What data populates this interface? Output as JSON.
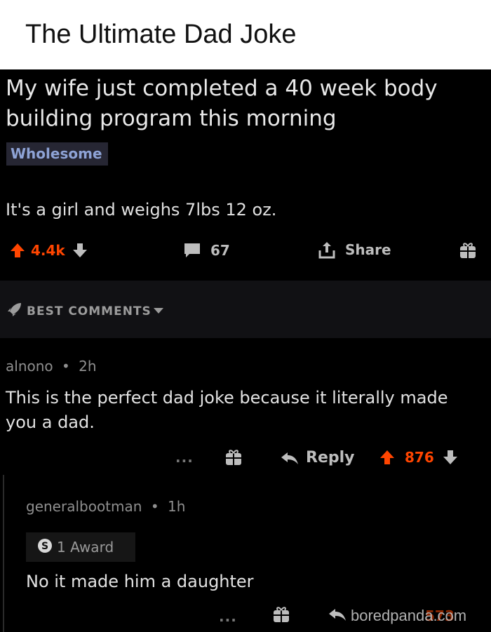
{
  "article_title": "The Ultimate Dad Joke",
  "post": {
    "title": "My wife just completed a 40 week body building program this morning",
    "flair": "Wholesome",
    "body": "It's a girl and weighs 7lbs 12 oz.",
    "score": "4.4k",
    "comment_count": "67",
    "share_label": "Share"
  },
  "sort": {
    "label": "BEST COMMENTS"
  },
  "comments": [
    {
      "author": "alnono",
      "age": "2h",
      "text": "This is the perfect dad joke because it literally made you a dad.",
      "more": "...",
      "reply_label": "Reply",
      "score": "876"
    },
    {
      "author": "generalbootman",
      "age": "1h",
      "award": "1 Award",
      "text": "No it made him a daughter",
      "more": "...",
      "score": "573"
    }
  ],
  "watermark": "boredpanda.com",
  "colors": {
    "upvote": "#ff4500",
    "downvote": "#bdbdbd",
    "flair_text": "#8ea3d6",
    "background": "#000000"
  }
}
